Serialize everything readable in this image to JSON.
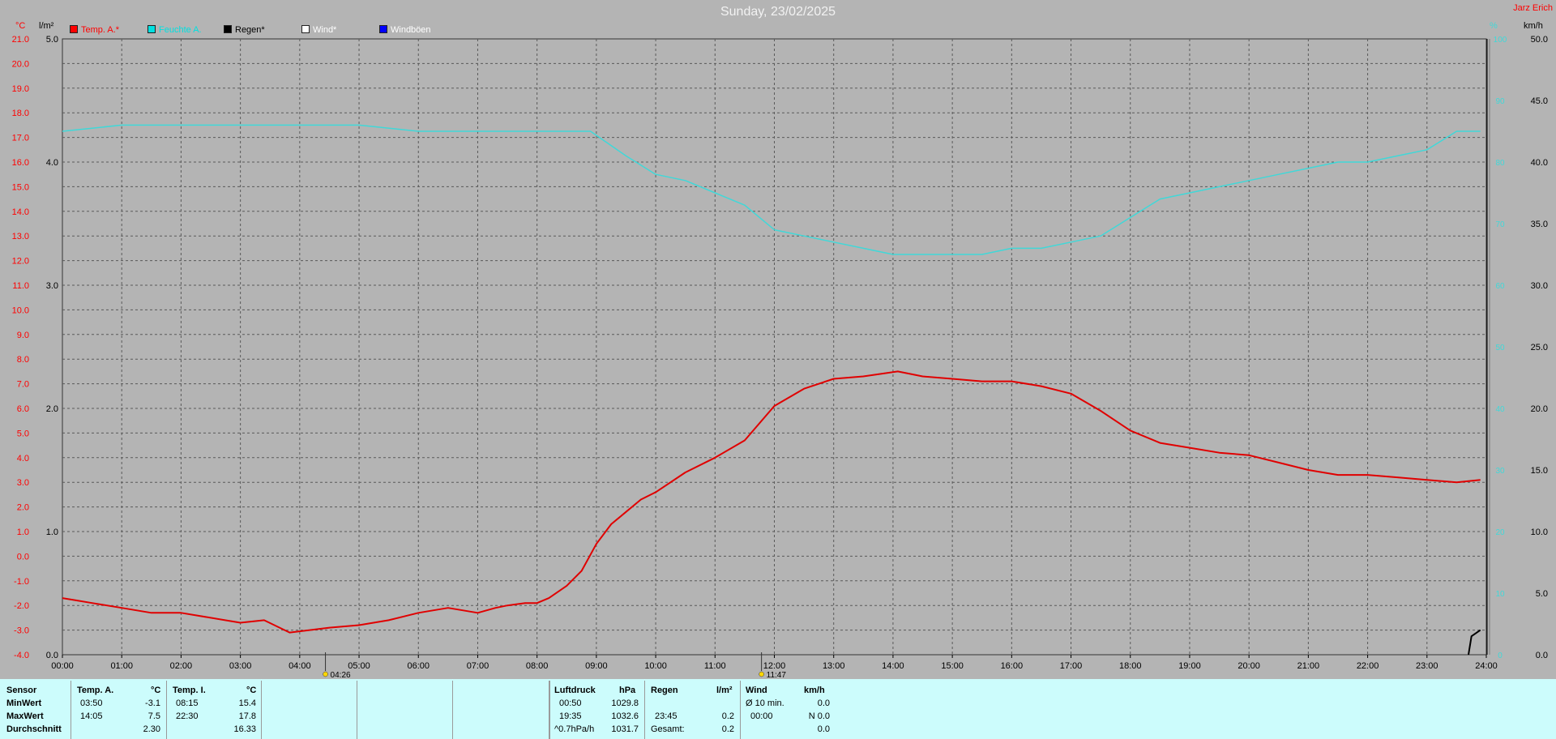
{
  "title": "Sunday, 23/02/2025",
  "brand": "Jarz Erich",
  "legend": [
    {
      "label": "Temp. A.*",
      "color": "#ff0000"
    },
    {
      "label": "Feuchte A.",
      "color": "#00e0e0"
    },
    {
      "label": "Regen*",
      "color": "#000000"
    },
    {
      "label": "Wind*",
      "color": "#ffffff"
    },
    {
      "label": "Windböen",
      "color": "#0000ff"
    }
  ],
  "units": {
    "temp": "°C",
    "rain": "l/m²",
    "hum": "%",
    "wind": "km/h"
  },
  "colors": {
    "temp": "#e00000",
    "hum": "#40d8d8",
    "rain": "#000000",
    "grid": "#555555",
    "background": "#b4b4b4"
  },
  "chart_data": {
    "type": "line",
    "x_ticks": [
      "00:00",
      "01:00",
      "02:00",
      "03:00",
      "04:00",
      "05:00",
      "06:00",
      "07:00",
      "08:00",
      "09:00",
      "10:00",
      "11:00",
      "12:00",
      "13:00",
      "14:00",
      "15:00",
      "16:00",
      "17:00",
      "18:00",
      "19:00",
      "20:00",
      "21:00",
      "22:00",
      "23:00",
      "24:00"
    ],
    "axes": {
      "temp": {
        "label": "°C",
        "range": [
          -4.0,
          21.0
        ],
        "ticks": [
          "21.0",
          "20.0",
          "19.0",
          "18.0",
          "17.0",
          "16.0",
          "15.0",
          "14.0",
          "13.0",
          "12.0",
          "11.0",
          "10.0",
          "9.0",
          "8.0",
          "7.0",
          "6.0",
          "5.0",
          "4.0",
          "3.0",
          "2.0",
          "1.0",
          "0.0",
          "-1.0",
          "-2.0",
          "-3.0",
          "-4.0"
        ]
      },
      "rain": {
        "label": "l/m²",
        "range": [
          0,
          5.0
        ],
        "ticks": [
          "5.0",
          "4.0",
          "3.0",
          "2.0",
          "1.0",
          "0.0"
        ]
      },
      "humidity": {
        "label": "%",
        "range": [
          0,
          100
        ],
        "ticks": [
          "100",
          "90",
          "80",
          "70",
          "60",
          "50",
          "40",
          "30",
          "20",
          "10",
          "0"
        ]
      },
      "wind": {
        "label": "km/h",
        "range": [
          0,
          50.0
        ],
        "ticks": [
          "50.0",
          "45.0",
          "40.0",
          "35.0",
          "30.0",
          "25.0",
          "20.0",
          "15.0",
          "10.0",
          "5.0",
          "0.0"
        ]
      }
    },
    "series": [
      {
        "name": "Temp. A.",
        "axis": "temp",
        "x": [
          0,
          0.25,
          0.5,
          1,
          1.5,
          2,
          2.5,
          3,
          3.4,
          3.83,
          4.5,
          5,
          5.5,
          6,
          6.5,
          7,
          7.3,
          7.5,
          7.8,
          8,
          8.2,
          8.5,
          8.75,
          9,
          9.25,
          9.5,
          9.75,
          10,
          10.5,
          11,
          11.5,
          12,
          12.5,
          13,
          13.5,
          14.08,
          14.5,
          15,
          15.5,
          16,
          16.5,
          17,
          17.5,
          18,
          18.5,
          19,
          19.5,
          20,
          20.5,
          21,
          21.5,
          22,
          22.5,
          23,
          23.5,
          23.9
        ],
        "y": [
          -1.7,
          -1.8,
          -1.9,
          -2.1,
          -2.3,
          -2.3,
          -2.5,
          -2.7,
          -2.6,
          -3.1,
          -2.9,
          -2.8,
          -2.6,
          -2.3,
          -2.1,
          -2.3,
          -2.1,
          -2.0,
          -1.9,
          -1.9,
          -1.7,
          -1.2,
          -0.6,
          0.5,
          1.3,
          1.8,
          2.3,
          2.6,
          3.4,
          4.0,
          4.7,
          6.1,
          6.8,
          7.2,
          7.3,
          7.5,
          7.3,
          7.2,
          7.1,
          7.1,
          6.9,
          6.6,
          5.9,
          5.1,
          4.6,
          4.4,
          4.2,
          4.1,
          3.8,
          3.5,
          3.3,
          3.3,
          3.2,
          3.1,
          3.0,
          3.1
        ]
      },
      {
        "name": "Feuchte A.",
        "axis": "humidity",
        "x": [
          0,
          0.5,
          1,
          1.5,
          2,
          3,
          4,
          5,
          6,
          7,
          8,
          8.9,
          9.5,
          10,
          10.5,
          11,
          11.5,
          12,
          12.5,
          13,
          13.5,
          14,
          14.5,
          15,
          15.5,
          16,
          16.5,
          17,
          17.5,
          18,
          18.5,
          19,
          19.5,
          20,
          20.5,
          21,
          21.5,
          22,
          22.5,
          23,
          23.5,
          23.9
        ],
        "y": [
          85,
          85.5,
          86,
          86,
          86,
          86,
          86,
          86,
          85,
          85,
          85,
          85,
          81,
          78,
          77,
          75,
          73,
          69,
          68,
          67,
          66,
          65,
          65,
          65,
          65,
          66,
          66,
          67,
          68,
          71,
          74,
          75,
          76,
          77,
          78,
          79,
          80,
          80,
          81,
          82,
          85,
          85
        ]
      },
      {
        "name": "Regen",
        "axis": "rain",
        "x": [
          23.7,
          23.75,
          23.9
        ],
        "y": [
          0,
          0.15,
          0.2
        ]
      }
    ]
  },
  "markers": [
    {
      "time": "04:26",
      "icon": "sunrise-icon"
    },
    {
      "time": "11:47",
      "icon": "sun-noon-icon"
    }
  ],
  "stats": {
    "row_labels": [
      "Sensor",
      "MinWert",
      "MaxWert",
      "Durchschnitt"
    ],
    "temp_a": {
      "header": "Temp. A.",
      "unit": "°C",
      "min_time": "03:50",
      "min": "-3.1",
      "max_time": "14:05",
      "max": "7.5",
      "avg": "2.30"
    },
    "temp_i": {
      "header": "Temp. I.",
      "unit": "°C",
      "min_time": "08:15",
      "min": "15.4",
      "max_time": "22:30",
      "max": "17.8",
      "avg": "16.33"
    },
    "pressure": {
      "header": "Luftdruck",
      "unit": "hPa",
      "min_time": "00:50",
      "min": "1029.8",
      "max_time": "19:35",
      "max": "1032.6",
      "trend": "^0.7hPa/h",
      "avg": "1031.7"
    },
    "rain": {
      "header": "Regen",
      "unit": "l/m²",
      "max_time": "23:45",
      "max": "0.2",
      "total_label": "Gesamt:",
      "total": "0.2"
    },
    "wind": {
      "header": "Wind",
      "unit": "km/h",
      "avg_label": "Ø 10 min.",
      "avg": "0.0",
      "max_time": "00:00",
      "max": "N 0.0",
      "day_avg": "0.0"
    }
  }
}
